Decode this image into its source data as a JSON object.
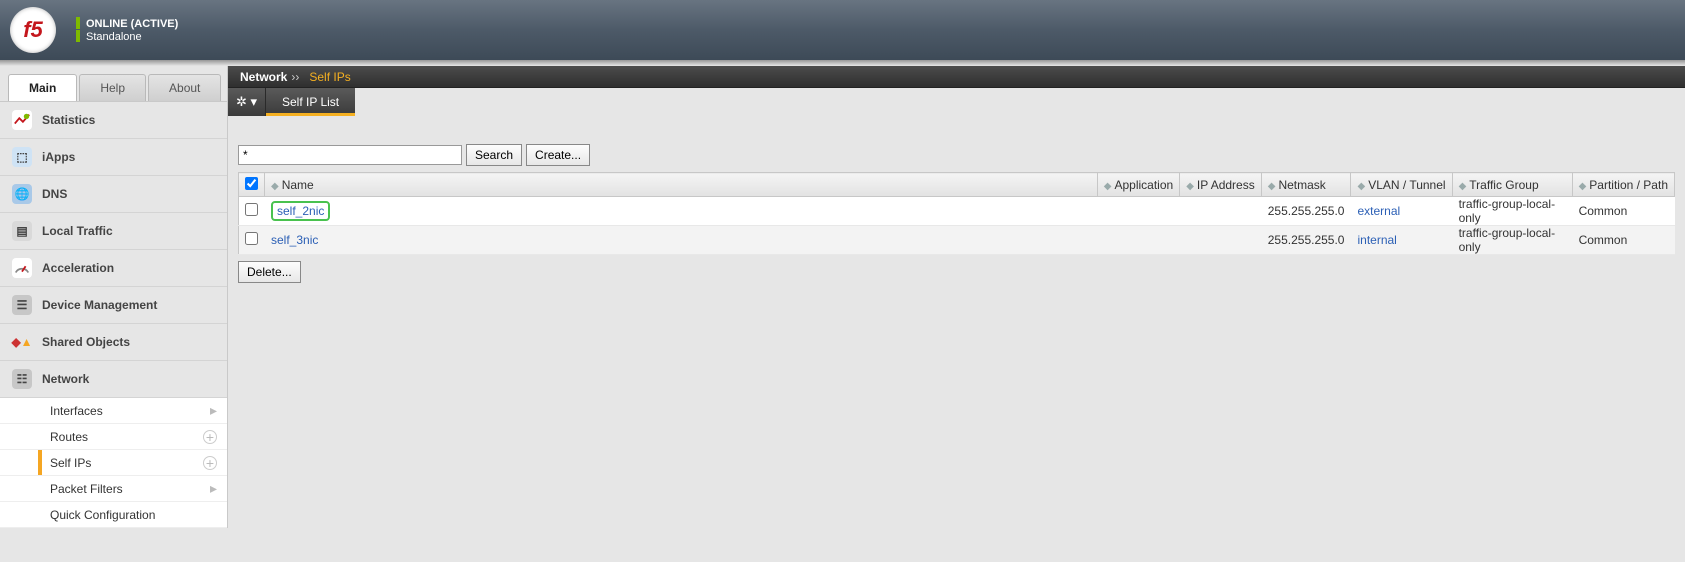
{
  "header": {
    "status1": "ONLINE (ACTIVE)",
    "status2": "Standalone",
    "logo_text": "f5"
  },
  "tabs": {
    "main": "Main",
    "help": "Help",
    "about": "About"
  },
  "sidenav": {
    "statistics": "Statistics",
    "iapps": "iApps",
    "dns": "DNS",
    "local_traffic": "Local Traffic",
    "acceleration": "Acceleration",
    "device_mgmt": "Device Management",
    "shared_objects": "Shared Objects",
    "network": "Network",
    "sub": {
      "interfaces": "Interfaces",
      "routes": "Routes",
      "self_ips": "Self IPs",
      "packet_filters": "Packet Filters",
      "quick_config": "Quick Configuration"
    }
  },
  "breadcrumb": {
    "root": "Network",
    "leaf": "Self IPs"
  },
  "subtab": {
    "gear": "✲ ▾",
    "list": "Self IP List"
  },
  "toolbar": {
    "search_value": "*",
    "search_btn": "Search",
    "create_btn": "Create...",
    "delete_btn": "Delete..."
  },
  "columns": {
    "name": "Name",
    "application": "Application",
    "ip": "IP Address",
    "netmask": "Netmask",
    "vlan": "VLAN / Tunnel",
    "tg": "Traffic Group",
    "partition": "Partition / Path"
  },
  "rows": [
    {
      "name": "self_2nic",
      "app": "",
      "ip": "",
      "netmask": "255.255.255.0",
      "vlan": "external",
      "tg": "traffic-group-local-only",
      "partition": "Common",
      "highlight": true
    },
    {
      "name": "self_3nic",
      "app": "",
      "ip": "",
      "netmask": "255.255.255.0",
      "vlan": "internal",
      "tg": "traffic-group-local-only",
      "partition": "Common",
      "highlight": false
    }
  ]
}
